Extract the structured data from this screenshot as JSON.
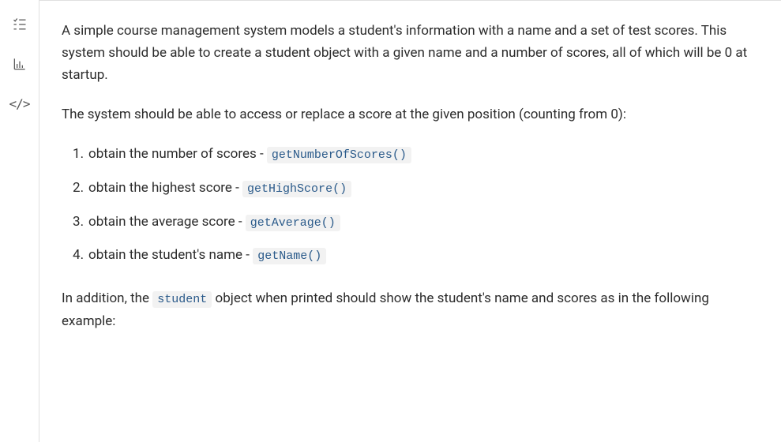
{
  "sidebar": {
    "icons": [
      {
        "name": "checklist-icon"
      },
      {
        "name": "bar-chart-icon"
      },
      {
        "name": "code-icon"
      }
    ]
  },
  "content": {
    "paragraph1": "A simple course management system models a student's information with a name and a set of test scores. This system should be able to create a student object with a given name and a number of scores, all of which will be 0 at startup.",
    "paragraph2": "The system should be able to access or replace a score at the given position (counting from 0):",
    "list": [
      {
        "text": "obtain the number of scores - ",
        "code": "getNumberOfScores()"
      },
      {
        "text": "obtain the highest score - ",
        "code": "getHighScore()"
      },
      {
        "text": "obtain the average score - ",
        "code": "getAverage()"
      },
      {
        "text": "obtain the student's name - ",
        "code": "getName()"
      }
    ],
    "paragraph3_prefix": "In addition, the ",
    "paragraph3_code": "student",
    "paragraph3_suffix": " object when printed should show the student's name and scores as in the following example:"
  }
}
